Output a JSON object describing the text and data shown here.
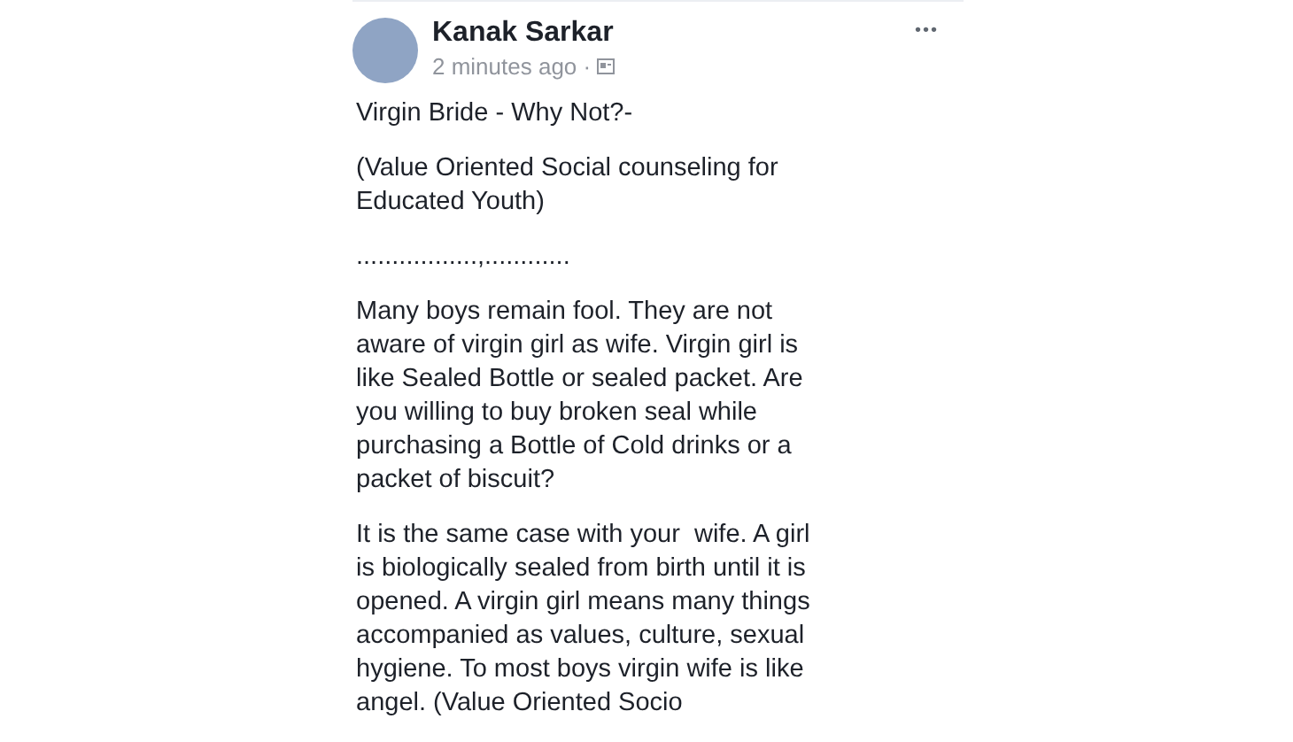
{
  "post": {
    "author": "Kanak Sarkar",
    "time": "2 minutes ago ·",
    "more": "•••",
    "paragraphs": [
      [
        "Virgin Bride - Why Not?-"
      ],
      [
        "(Value Oriented Social counseling for",
        "Educated Youth)"
      ],
      [
        ".................,............"
      ],
      [
        "Many boys remain fool. They are not",
        "aware of virgin girl as wife. Virgin girl is",
        "like Sealed Bottle or sealed packet. Are",
        "you willing to buy broken seal while",
        "purchasing a Bottle of Cold drinks or a",
        "packet of biscuit?"
      ],
      [
        "It is the same case with your  wife. A girl",
        "is biologically sealed from birth until it is",
        "opened. A virgin girl means many things",
        "accompanied as values, culture, sexual",
        "hygiene. To most boys virgin wife is like",
        "angel. (Value Oriented Socio"
      ]
    ]
  }
}
